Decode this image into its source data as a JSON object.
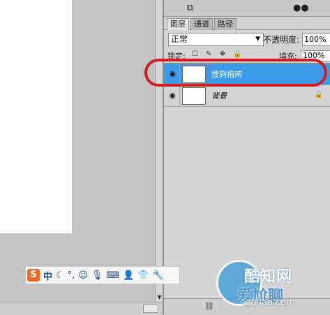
{
  "panel": {
    "tabs": [
      "图层",
      "通道",
      "路径"
    ],
    "blend_mode": "正常",
    "opacity_label": "不透明度:",
    "opacity_value": "100%",
    "lock_label": "锁定:",
    "fill_label": "填充:",
    "fill_value": "100%"
  },
  "layers": [
    {
      "name": "搜狗指南",
      "selected": true,
      "thumbnail": "transparent-checker"
    },
    {
      "name": "背景",
      "selected": false,
      "thumbnail": "white",
      "locked": true
    }
  ],
  "ime": {
    "logo": "S",
    "mode": "中",
    "items": [
      "moon-icon",
      "punctuation-icon",
      "emoji-icon",
      "microphone-icon",
      "keyboard-icon",
      "user-icon",
      "skin-icon",
      "tool-icon"
    ]
  },
  "watermark": {
    "line1": "酷知网",
    "line2": "爱尬聊",
    "url": "igaliao.com"
  },
  "colors": {
    "selected_layer": "#3c9ae8",
    "annotation": "#d11a22"
  }
}
